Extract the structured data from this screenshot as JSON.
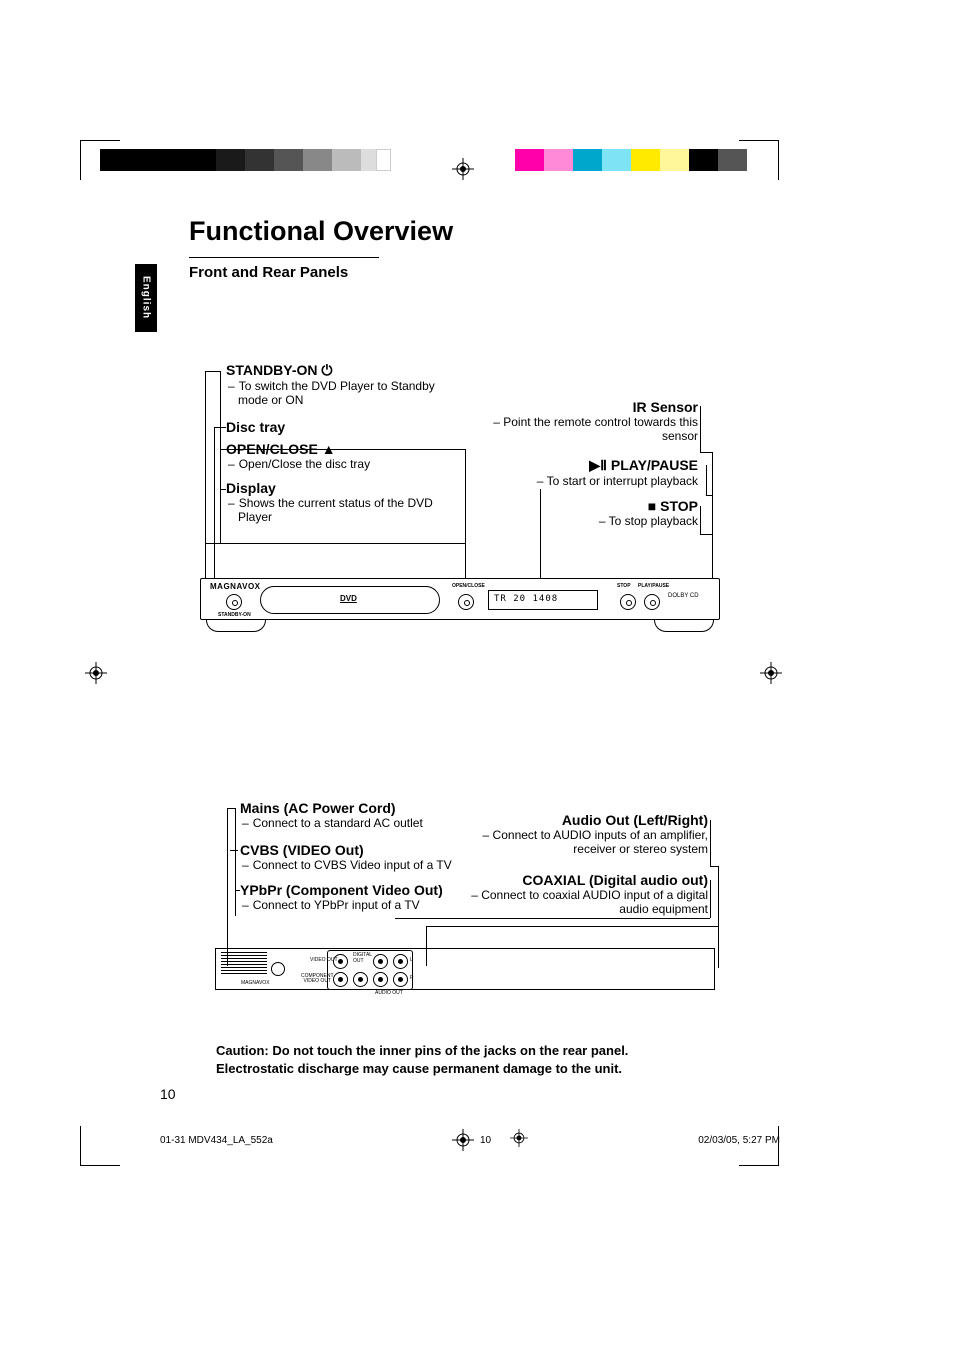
{
  "language_tab": "English",
  "page_title": "Functional Overview",
  "section_title": "Front and Rear Panels",
  "front": {
    "standby": {
      "title": "STANDBY-ON",
      "icon": "⏻",
      "desc": "To switch the DVD Player to Standby mode or ON"
    },
    "disc_tray": {
      "title": "Disc tray"
    },
    "open_close": {
      "title": "OPEN/CLOSE",
      "icon": "▲",
      "desc": "Open/Close the disc tray"
    },
    "display": {
      "title": "Display",
      "desc": "Shows the current status of the DVD Player"
    },
    "ir": {
      "title": "IR Sensor",
      "desc": "– Point the remote control towards this sensor"
    },
    "play_pause": {
      "title": " PLAY/PAUSE",
      "icon": "▶Ⅱ",
      "desc": "– To start or interrupt playback"
    },
    "stop": {
      "title": " STOP",
      "icon": "■",
      "desc": "– To stop playback"
    }
  },
  "front_device": {
    "brand": "MAGNAVOX",
    "dvd_logo": "DVD",
    "open_close_label": "OPEN/CLOSE",
    "standby_label": "STANDBY-ON",
    "display_text": "TR 20 1408",
    "stop_label": "STOP",
    "play_label": "PLAY/PAUSE",
    "badges": "DOLBY  CD"
  },
  "rear": {
    "mains": {
      "title": "Mains (AC Power Cord)",
      "desc": "Connect to a standard AC outlet"
    },
    "cvbs": {
      "title": "CVBS (VIDEO Out)",
      "desc": "Connect to CVBS Video input of a TV"
    },
    "ypbpr": {
      "title": "YPbPr (Component Video Out)",
      "desc": "Connect to YPbPr input of a TV"
    },
    "audio": {
      "title": "Audio Out (Left/Right)",
      "desc": "– Connect to AUDIO inputs of an amplifier, receiver or stereo system"
    },
    "coax": {
      "title": "COAXIAL (Digital audio out)",
      "desc": "–  Connect to coaxial AUDIO input of a digital audio equipment"
    }
  },
  "rear_device": {
    "brand": "MAGNAVOX"
  },
  "caution_line1": "Caution: Do not touch the inner pins of the jacks on the rear panel.",
  "caution_line2": "Electrostatic discharge may cause permanent damage to the unit.",
  "page_number": "10",
  "footer": {
    "left": "01-31 MDV434_LA_552a",
    "mid": "10",
    "right": "02/03/05, 5:27 PM"
  }
}
